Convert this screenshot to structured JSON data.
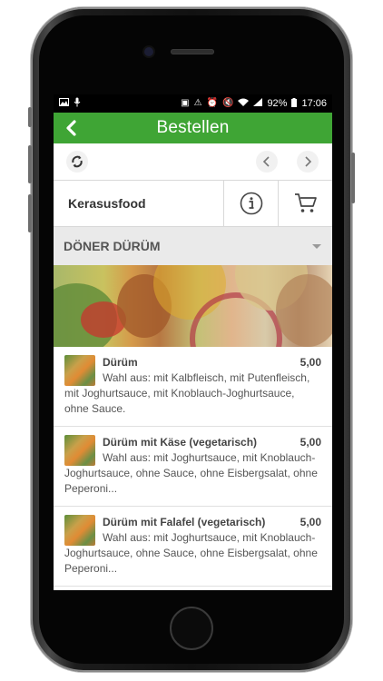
{
  "statusbar": {
    "battery": "92%",
    "time": "17:06"
  },
  "appbar": {
    "title": "Bestellen",
    "back_icon": "chevron-left-icon"
  },
  "toolbar": {
    "refresh_icon": "refresh-icon",
    "prev_icon": "chevron-left-icon",
    "next_icon": "chevron-right-icon"
  },
  "shop": {
    "name": "Kerasusfood",
    "info_icon": "info-icon",
    "cart_icon": "cart-icon"
  },
  "category": {
    "title": "DÖNER DÜRÜM"
  },
  "items": [
    {
      "name": "Dürüm",
      "price": "5,00",
      "description": "Wahl aus: mit Kalbfleisch, mit Putenfleisch, mit Joghurtsauce, mit Knoblauch-Joghurtsauce, ohne Sauce."
    },
    {
      "name": "Dürüm mit Käse (vegetarisch)",
      "price": "5,00",
      "description": "Wahl aus: mit Joghurtsauce, mit Knoblauch-Joghurtsauce, ohne Sauce, ohne Eisbergsalat, ohne Peperoni..."
    },
    {
      "name": "Dürüm mit Falafel (vegetarisch)",
      "price": "5,00",
      "description": "Wahl aus: mit Joghurtsauce, mit Knoblauch-Joghurtsauce, ohne Sauce, ohne Eisbergsalat, ohne Peperoni..."
    }
  ],
  "colors": {
    "brand_green": "#3fa535",
    "category_bg": "#eaeaea"
  }
}
